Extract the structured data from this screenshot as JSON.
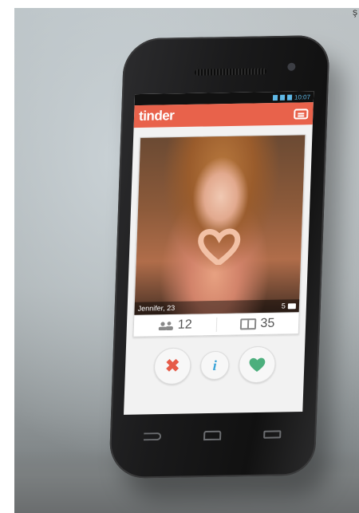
{
  "corner_text": "ş",
  "status": {
    "time": "10:07"
  },
  "app": {
    "title": "tinder"
  },
  "profile": {
    "caption": "Jennifer, 23",
    "photo_count": "5"
  },
  "stats": {
    "friends": "12",
    "interests": "35"
  },
  "actions": {
    "reject_icon": "x-icon",
    "info_icon": "info-icon",
    "like_icon": "heart-icon",
    "info_glyph": "i"
  },
  "colors": {
    "accent": "#e8624b",
    "reject": "#e65b48",
    "info": "#38a3d8",
    "like": "#4caf7d"
  }
}
